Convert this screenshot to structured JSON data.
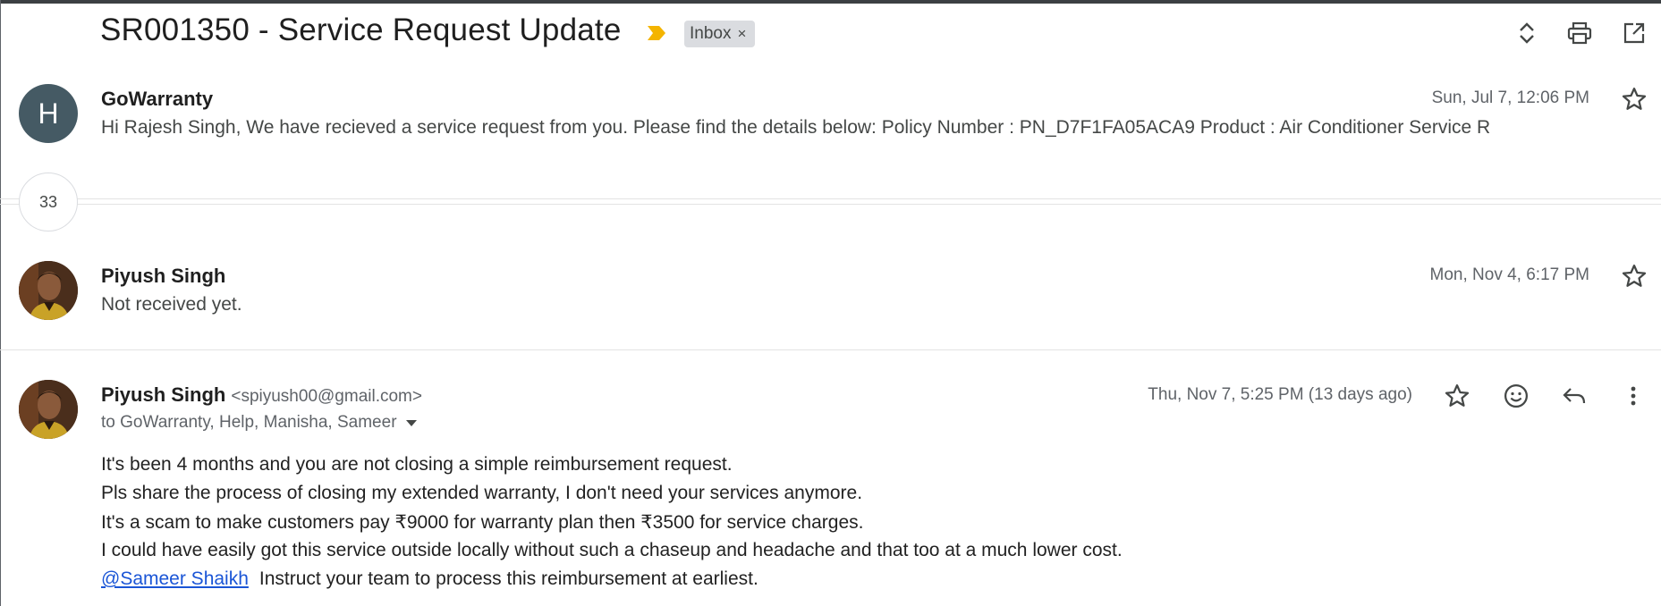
{
  "thread": {
    "subject": "SR001350 - Service Request Update",
    "label": "Inbox",
    "label_remove": "×",
    "important_color": "#f4b400"
  },
  "messages": [
    {
      "avatar_letter": "H",
      "sender": "GoWarranty",
      "date": "Sun, Jul 7, 12:06 PM",
      "snippet": "Hi Rajesh Singh, We have recieved a service request from you. Please find the details below: Policy Number : PN_D7F1FA05ACA9 Product : Air Conditioner Service R"
    },
    {
      "sender": "Piyush Singh",
      "date": "Mon, Nov 4, 6:17 PM",
      "snippet": "Not received yet."
    }
  ],
  "collapsed_count": "33",
  "open_message": {
    "sender": "Piyush Singh",
    "email": "<spiyush00@gmail.com>",
    "date": "Thu, Nov 7, 5:25 PM (13 days ago)",
    "to": "to GoWarranty, Help, Manisha, Sameer",
    "body": [
      "It's been 4 months and you are not closing a simple reimbursement request.",
      "Pls share the process of closing my extended warranty, I don't need your services anymore.",
      "It's a scam to make customers pay ₹9000 for warranty plan then ₹3500 for service charges.",
      "I could have easily got this service outside locally without such a chaseup and headache and that too at a much lower cost."
    ],
    "mention": "@Sameer Shaikh",
    "mention_text": "Instruct your team to process this reimbursement at earliest."
  },
  "colors": {
    "link": "#1a55d6",
    "avatar_bg": "#455a64"
  }
}
